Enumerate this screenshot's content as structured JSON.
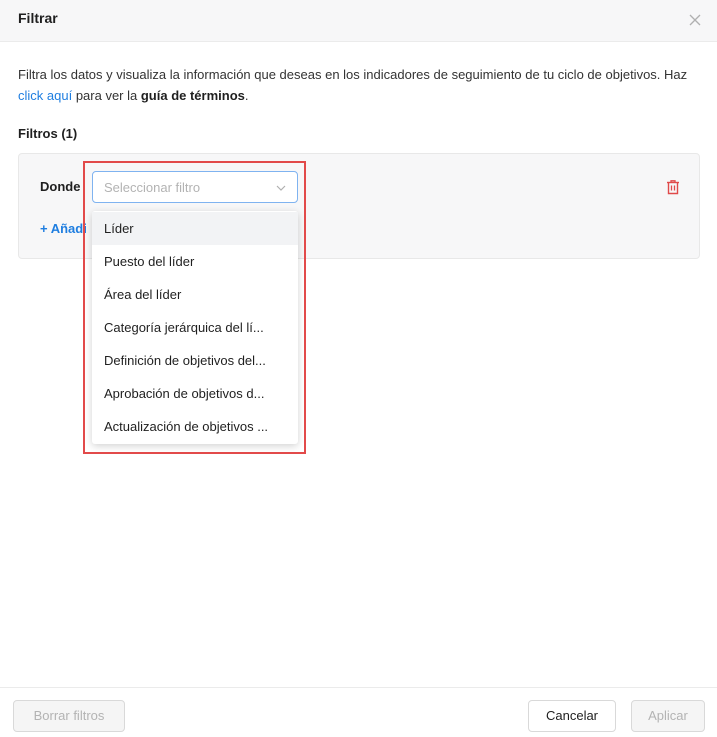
{
  "header": {
    "title": "Filtrar"
  },
  "intro": {
    "text_before_link": "Filtra los datos y visualiza la información que deseas en los indicadores de seguimiento de tu ciclo de objetivos. Haz ",
    "link_text": "click aquí",
    "text_middle": " para ver la ",
    "bold_text": "guía de términos",
    "text_end": "."
  },
  "filters": {
    "title": "Filtros (1)",
    "donde_label": "Donde",
    "select_placeholder": "Seleccionar filtro",
    "add_label": "+ Añadi",
    "options": [
      "Líder",
      "Puesto del líder",
      "Área del líder",
      "Categoría jerárquica del lí...",
      "Definición de objetivos del...",
      "Aprobación de objetivos d...",
      "Actualización de objetivos ..."
    ]
  },
  "footer": {
    "clear_label": "Borrar filtros",
    "cancel_label": "Cancelar",
    "apply_label": "Aplicar"
  },
  "colors": {
    "link": "#1f7ee0",
    "delete": "#e04a4a",
    "highlight": "#e24a4a"
  },
  "icons": [
    "close-icon",
    "chevron-down-icon",
    "trash-icon"
  ]
}
